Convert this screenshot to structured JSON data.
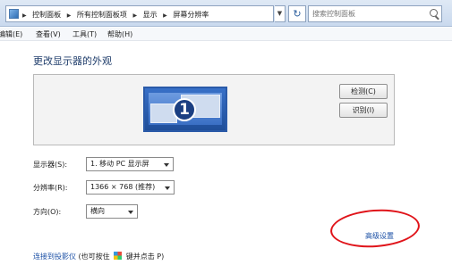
{
  "address_bar": {
    "crumbs": [
      "控制面板",
      "所有控制面板项",
      "显示",
      "屏幕分辨率"
    ],
    "search_placeholder": "搜索控制面板"
  },
  "menu": {
    "items": [
      "编辑(E)",
      "查看(V)",
      "工具(T)",
      "帮助(H)"
    ]
  },
  "main": {
    "title": "更改显示器的外观",
    "monitor_number": "1",
    "buttons": {
      "detect": "检测(C)",
      "identify": "识别(I)"
    },
    "fields": {
      "display": {
        "label": "显示器(S):",
        "value": "1. 移动 PC 显示屏"
      },
      "resolution": {
        "label": "分辨率(R):",
        "value": "1366 × 768 (推荐)"
      },
      "orientation": {
        "label": "方向(O):",
        "value": "横向"
      }
    },
    "advanced_link": "高级设置",
    "footer": {
      "link": "连接到投影仪",
      "hint_before": "(也可按住",
      "hint_after": "键并点击 P)"
    }
  },
  "annotation_color": "#e0141a"
}
